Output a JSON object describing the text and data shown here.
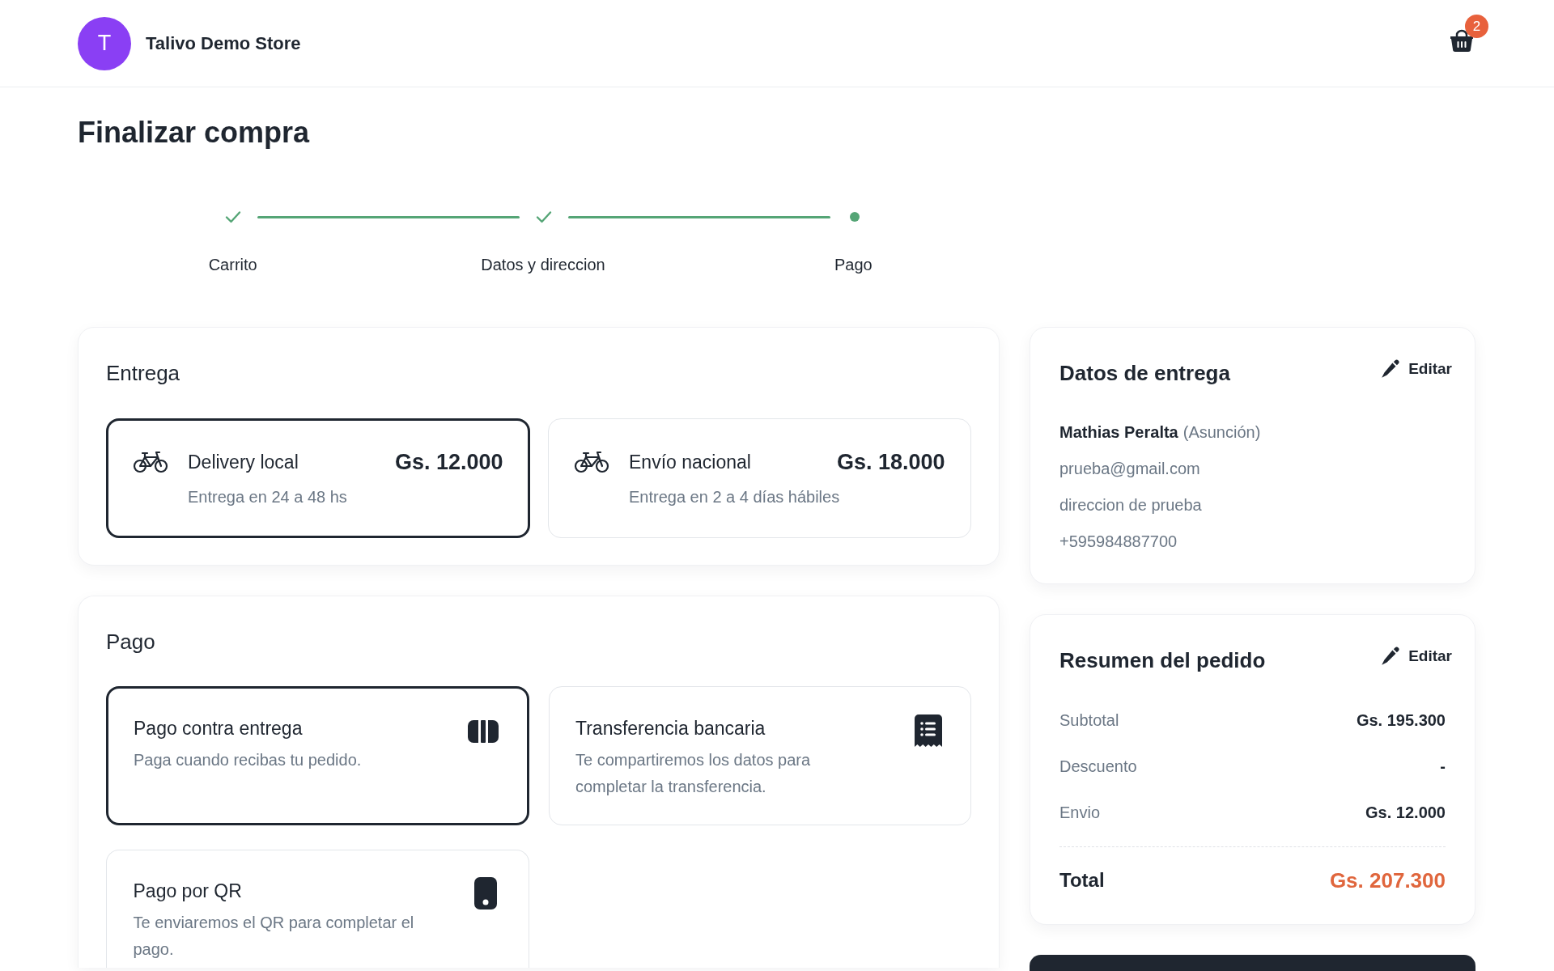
{
  "header": {
    "avatar_letter": "T",
    "store_name": "Talivo Demo Store",
    "cart_count": "2"
  },
  "page_title": "Finalizar compra",
  "steps": [
    {
      "label": "Carrito",
      "completed": true
    },
    {
      "label": "Datos y direccion",
      "completed": true
    },
    {
      "label": "Pago",
      "completed": false
    }
  ],
  "delivery": {
    "title": "Entrega",
    "options": [
      {
        "name": "Delivery local",
        "price": "Gs. 12.000",
        "description": "Entrega en 24 a 48 hs",
        "selected": true
      },
      {
        "name": "Envío nacional",
        "price": "Gs. 18.000",
        "description": "Entrega en 2 a 4 días hábiles",
        "selected": false
      }
    ]
  },
  "payment": {
    "title": "Pago",
    "options": [
      {
        "kind": "cash",
        "name": "Pago contra entrega",
        "description": "Paga cuando recibas tu pedido.",
        "selected": true
      },
      {
        "kind": "transfer",
        "name": "Transferencia bancaria",
        "description": "Te compartiremos los datos para completar la transferencia.",
        "selected": false
      },
      {
        "kind": "qr",
        "name": "Pago por QR",
        "description": "Te enviaremos el QR para completar el pago.",
        "selected": false
      }
    ]
  },
  "delivery_details": {
    "title": "Datos de entrega",
    "edit_label": "Editar",
    "name": "Mathias Peralta",
    "city": "(Asunción)",
    "email": "prueba@gmail.com",
    "address": "direccion de prueba",
    "phone": "+595984887700"
  },
  "order_summary": {
    "title": "Resumen del pedido",
    "edit_label": "Editar",
    "rows": [
      {
        "label": "Subtotal",
        "value": "Gs. 195.300"
      },
      {
        "label": "Descuento",
        "value": "-"
      },
      {
        "label": "Envio",
        "value": "Gs. 12.000"
      }
    ],
    "total": {
      "label": "Total",
      "value": "Gs. 207.300"
    }
  }
}
